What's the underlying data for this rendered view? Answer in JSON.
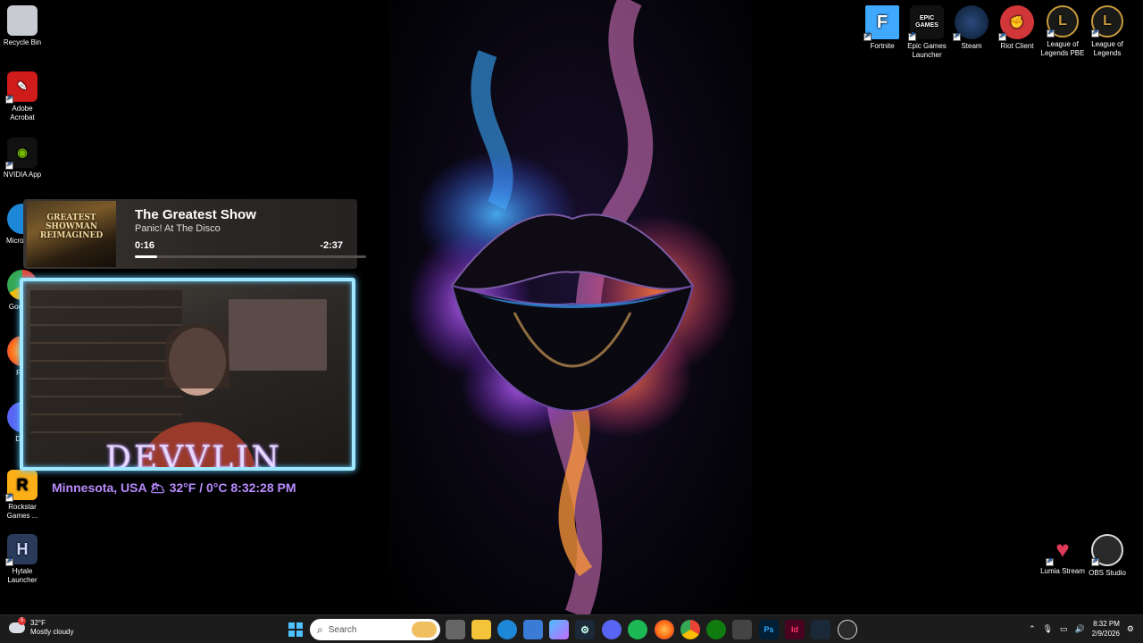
{
  "desktop_left": {
    "icons": [
      {
        "label": "Recycle Bin"
      },
      {
        "label": "Adobe Acrobat"
      },
      {
        "label": "NVIDIA App"
      },
      {
        "label": "Micro Edg"
      },
      {
        "label": "Goo Chr"
      },
      {
        "label": "Fire"
      },
      {
        "label": "Disc"
      },
      {
        "label": "Rockstar Games ..."
      },
      {
        "label": "Hytale Launcher"
      }
    ]
  },
  "desktop_right": {
    "icons": [
      {
        "label": "Fortnite"
      },
      {
        "label": "Epic Games Launcher",
        "glyph": "EPIC GAMES"
      },
      {
        "label": "Steam"
      },
      {
        "label": "Riot Client"
      },
      {
        "label": "League of Legends PBE"
      },
      {
        "label": "League of Legends"
      },
      {
        "label": "Lumia Stream"
      },
      {
        "label": "OBS Studio"
      }
    ]
  },
  "now_playing": {
    "album_art_text": "GREATEST SHOWMAN REIMAGINED",
    "title": "The Greatest Show",
    "artist": "Panic! At The Disco",
    "elapsed": "0:16",
    "remaining": "-2:37",
    "progress": 0.097
  },
  "webcam": {
    "overlay_name": "DEVVLIN",
    "location_weather": "Minnesota, USA  🌥  32°F / 0°C  8:32:28 PM"
  },
  "taskbar": {
    "weather_temp": "32°F",
    "weather_desc": "Mostly cloudy",
    "weather_badge": "5",
    "search_placeholder": "Search",
    "time": "8:32 PM",
    "date": "2/9/2026",
    "pinned_icons": [
      "windows-start-icon",
      "task-view-icon",
      "file-explorer-icon",
      "edge-icon",
      "ms-store-icon",
      "copilot-icon",
      "steam-icon",
      "discord-icon",
      "spotify-icon",
      "firefox-icon",
      "chrome-icon",
      "xbox-icon",
      "snipping-tool-icon",
      "photoshop-icon",
      "indesign-icon",
      "steam-icon-2",
      "obs-icon"
    ]
  },
  "colors": {
    "accent_purple": "#b98bff",
    "webcam_border": "#9fe8ff",
    "taskbar_bg": "#1c1c1c"
  }
}
